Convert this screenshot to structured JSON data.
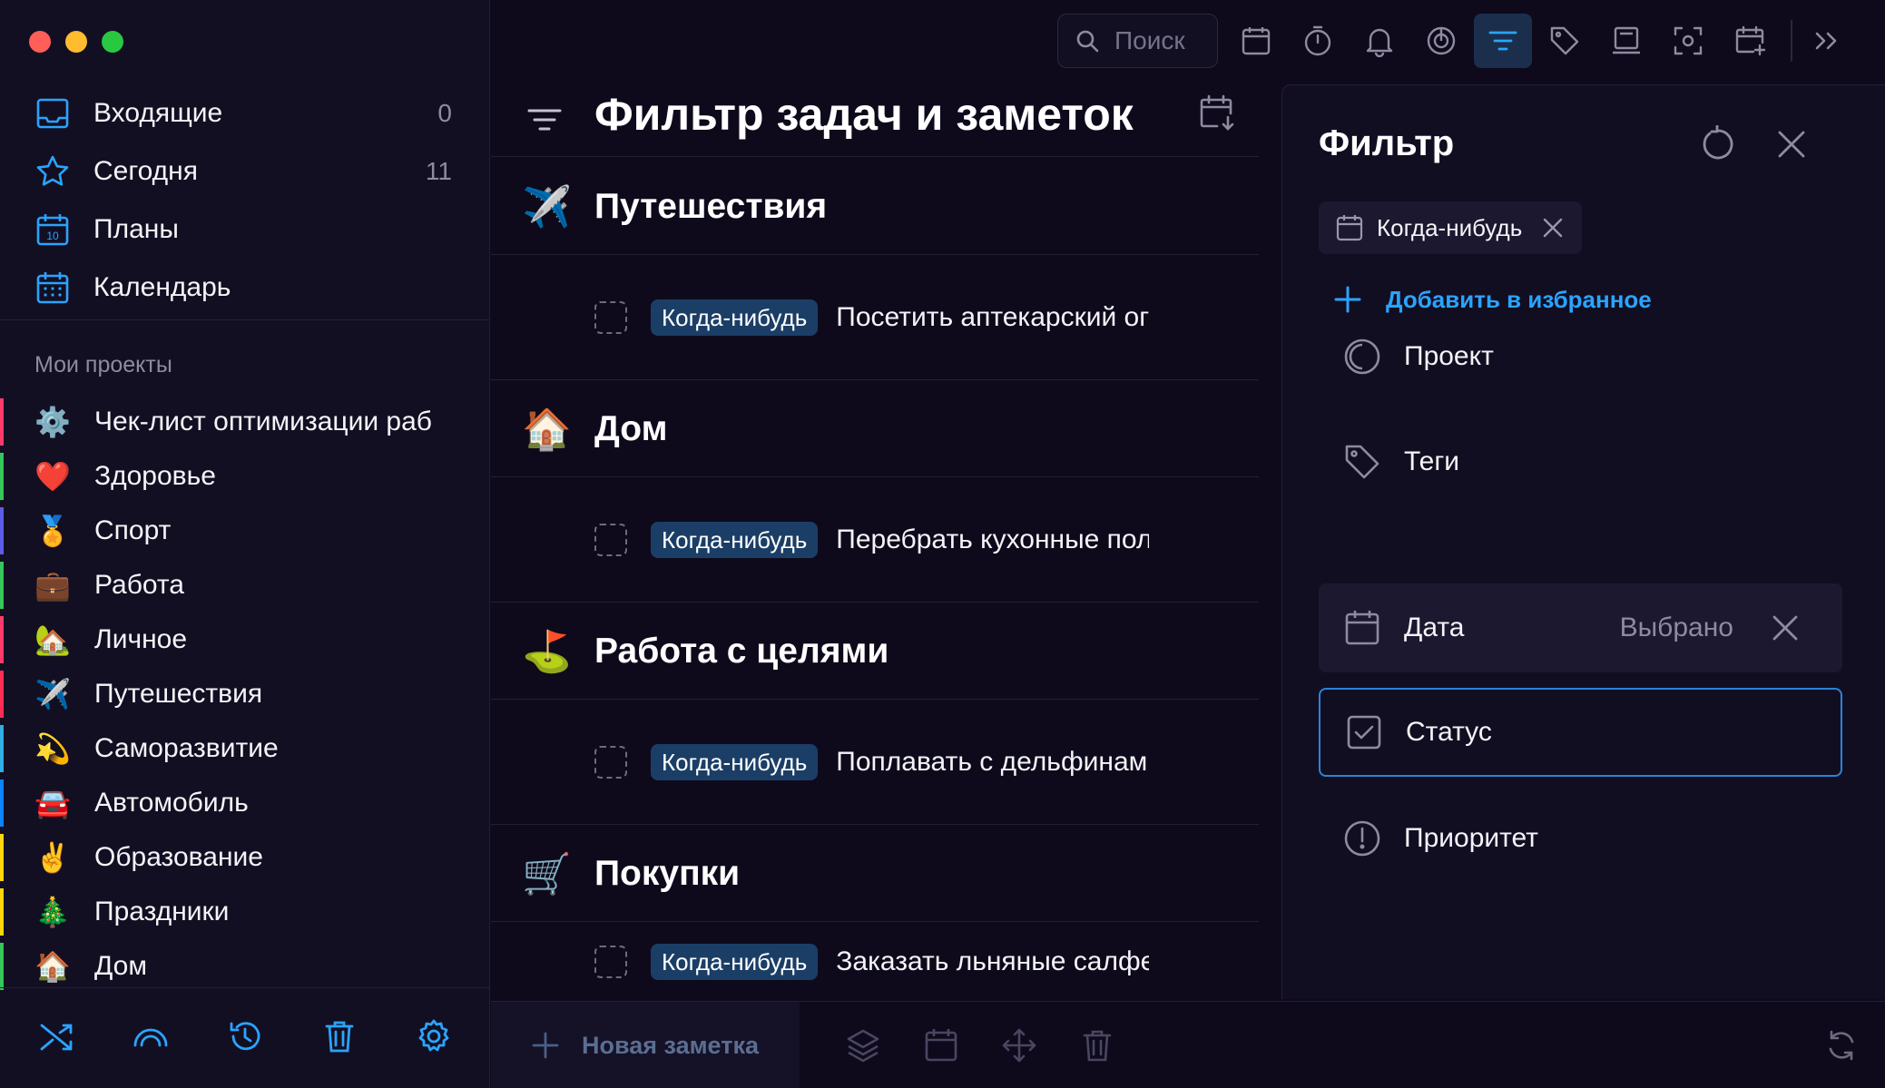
{
  "window": {
    "traffic_colors": [
      "#ff5f57",
      "#febc2e",
      "#28c840"
    ]
  },
  "accent": "#2aa4ff",
  "sidebar": {
    "nav": [
      {
        "icon": "inbox-icon",
        "label": "Входящие",
        "count": "0"
      },
      {
        "icon": "star-icon",
        "label": "Сегодня",
        "count": "11"
      },
      {
        "icon": "calendar-10-icon",
        "label": "Планы",
        "count": ""
      },
      {
        "icon": "calendar-grid-icon",
        "label": "Календарь",
        "count": ""
      }
    ],
    "projects_title": "Мои проекты",
    "projects": [
      {
        "emoji": "⚙️",
        "label": "Чек-лист оптимизации раб",
        "color": "#ff3b6b"
      },
      {
        "emoji": "❤️",
        "label": "Здоровье",
        "color": "#34c759"
      },
      {
        "emoji": "🏅",
        "label": "Спорт",
        "color": "#5e5ce6"
      },
      {
        "emoji": "💼",
        "label": "Работа",
        "color": "#34c759"
      },
      {
        "emoji": "🏡",
        "label": "Личное",
        "color": "#ff3b6b"
      },
      {
        "emoji": "✈️",
        "label": "Путешествия",
        "color": "#ff2d55"
      },
      {
        "emoji": "💫",
        "label": "Саморазвитие",
        "color": "#32ade6"
      },
      {
        "emoji": "🚘",
        "label": "Автомобиль",
        "color": "#0a84ff"
      },
      {
        "emoji": "✌️",
        "label": "Образование",
        "color": "#ffd60a"
      },
      {
        "emoji": "🎄",
        "label": "Праздники",
        "color": "#ffd60a"
      },
      {
        "emoji": "🏠",
        "label": "Дом",
        "color": "#34c759"
      }
    ],
    "tools": [
      "shuffle-icon",
      "rainbow-icon",
      "history-icon",
      "trash-icon",
      "settings-icon"
    ]
  },
  "toolbar": {
    "search_placeholder": "Поиск",
    "buttons": [
      "calendar-icon",
      "timer-icon",
      "bell-icon",
      "focus-icon",
      "filter-icon",
      "tag-icon",
      "card-icon",
      "scan-icon",
      "add-calendar-icon",
      "expand-icon"
    ],
    "active": "filter-icon"
  },
  "main": {
    "title": "Фильтр задач и заметок",
    "groups": [
      {
        "emoji": "✈️",
        "label": "Путешествия",
        "task": {
          "badge": "Когда-нибудь",
          "text": "Посетить аптекарский ог"
        }
      },
      {
        "emoji": "🏠",
        "label": "Дом",
        "task": {
          "badge": "Когда-нибудь",
          "text": "Перебрать кухонные пол"
        }
      },
      {
        "emoji": "⛳",
        "label": "Работа с целями",
        "task": {
          "badge": "Когда-нибудь",
          "text": "Поплавать с дельфинами"
        }
      },
      {
        "emoji": "🛒",
        "label": "Покупки",
        "task": {
          "badge": "Когда-нибудь",
          "text": "Заказать льняные салфе"
        }
      }
    ]
  },
  "filter_panel": {
    "title": "Фильтр",
    "chip": {
      "label": "Когда-нибудь"
    },
    "add_favorite": "Добавить в избранное",
    "rows": [
      {
        "icon": "project-icon",
        "label": "Проект",
        "value": ""
      },
      {
        "icon": "tag-icon",
        "label": "Теги",
        "value": ""
      },
      {
        "icon": "calendar-icon",
        "label": "Дата",
        "value": "Выбрано"
      },
      {
        "icon": "checkbox-icon",
        "label": "Статус",
        "value": ""
      },
      {
        "icon": "priority-icon",
        "label": "Приоритет",
        "value": ""
      }
    ]
  },
  "bottom": {
    "new_note": "Новая заметка",
    "tools": [
      "layers-icon",
      "calendar-icon",
      "move-icon",
      "trash-icon",
      "refresh-icon"
    ]
  }
}
